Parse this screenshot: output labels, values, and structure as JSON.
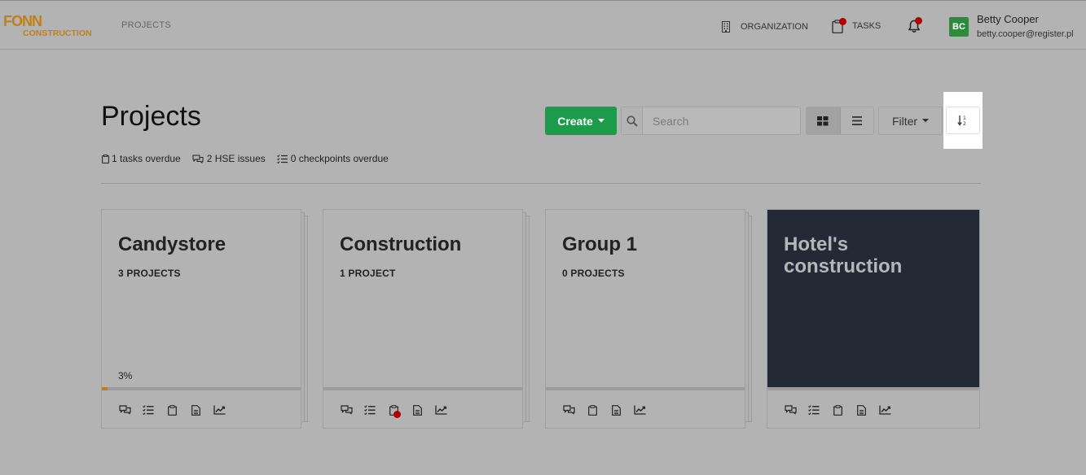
{
  "logo": {
    "line1": "FONN",
    "line2": "CONSTRUCTION",
    "color": "#c07f1a"
  },
  "nav": {
    "projects": "PROJECTS",
    "organization": "ORGANIZATION",
    "tasks": "TASKS"
  },
  "user": {
    "initials": "BC",
    "name": "Betty Cooper",
    "email": "betty.cooper@register.pl",
    "avatar_color": "#2e8b3e"
  },
  "page": {
    "title": "Projects"
  },
  "toolbar": {
    "create": "Create",
    "search_placeholder": "Search",
    "filter": "Filter"
  },
  "stats": {
    "tasks": "1 tasks overdue",
    "hse": "2 HSE issues",
    "checkpoints": "0 checkpoints overdue"
  },
  "cards": [
    {
      "title": "Candystore",
      "subtitle": "3 PROJECTS",
      "progress_label": "3%",
      "progress": 0.03
    },
    {
      "title": "Construction",
      "subtitle": "1 PROJECT",
      "progress_label": "",
      "progress": 0
    },
    {
      "title": "Group 1",
      "subtitle": "0 PROJECTS",
      "progress_label": "",
      "progress": 0
    },
    {
      "title": "Hotel's construction",
      "subtitle": "",
      "progress_label": "",
      "progress": 0
    }
  ],
  "colors": {
    "accent_green": "#1c9c4a",
    "alert_red": "#b00000",
    "dark_card": "#232a35",
    "progress_orange": "#c77a12"
  }
}
